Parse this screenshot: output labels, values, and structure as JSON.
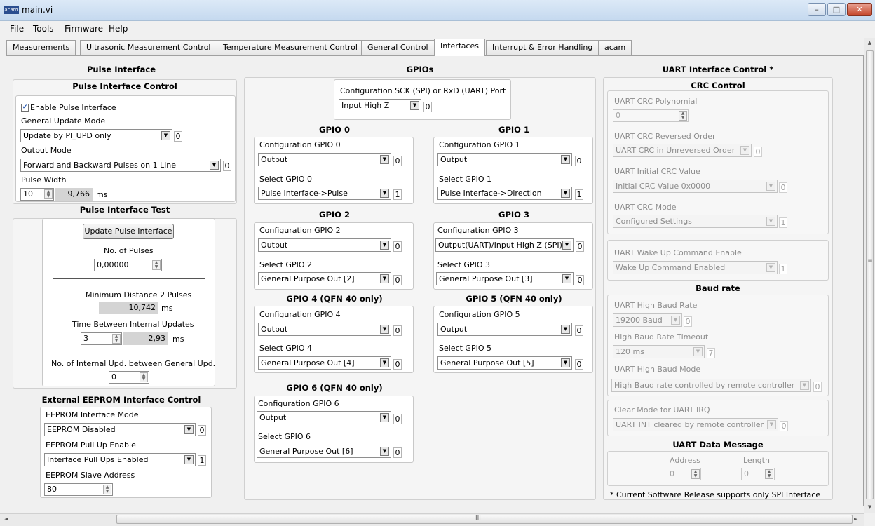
{
  "window": {
    "title": "main.vi",
    "icon_text": "acam",
    "minimize": "–",
    "maximize": "□",
    "close": "✕"
  },
  "menu": [
    "File",
    "Tools",
    "Firmware",
    "Help"
  ],
  "tabs": [
    "Measurements",
    "Ultrasonic Measurement Control",
    "Temperature Measurement Control",
    "General Control",
    "Interfaces",
    "Interrupt & Error Handling",
    "acam"
  ],
  "active_tab": "Interfaces",
  "pulse": {
    "title": "Pulse Interface",
    "control_title": "Pulse Interface Control",
    "enable_label": "Enable Pulse Interface",
    "enable_checked": true,
    "gum_label": "General Update Mode",
    "gum_value": "Update by PI_UPD only",
    "gum_idx": "0",
    "om_label": "Output Mode",
    "om_value": "Forward and Backward Pulses on 1 Line",
    "om_idx": "0",
    "pw_label": "Pulse Width",
    "pw_value": "10",
    "pw_ind": "9,766",
    "pw_unit": "ms",
    "test_title": "Pulse Interface Test",
    "update_btn": "Update Pulse Interface",
    "np_label": "No. of Pulses",
    "np_value": "0,00000",
    "md_label": "Minimum Distance 2 Pulses",
    "md_value": "10,742",
    "md_unit": "ms",
    "tb_label": "Time Between Internal Updates",
    "tb_value": "3",
    "tb_ind": "2,93",
    "tb_unit": "ms",
    "ni_label": "No. of Internal Upd. between General Upd.",
    "ni_value": "0"
  },
  "eeprom": {
    "title": "External EEPROM Interface Control",
    "mode_label": "EEPROM Interface Mode",
    "mode_value": "EEPROM Disabled",
    "mode_idx": "0",
    "pu_label": "EEPROM Pull Up Enable",
    "pu_value": "Interface Pull Ups Enabled",
    "pu_idx": "1",
    "sa_label": "EEPROM Slave Address",
    "sa_value": "80"
  },
  "gpios": {
    "title": "GPIOs",
    "sck_label": "Configuration SCK (SPI) or RxD (UART) Port",
    "sck_value": "Input High Z",
    "sck_idx": "0",
    "items": [
      {
        "title": "GPIO 0",
        "cfg_label": "Configuration GPIO 0",
        "cfg_value": "Output",
        "cfg_idx": "0",
        "sel_label": "Select GPIO 0",
        "sel_value": "Pulse Interface->Pulse",
        "sel_idx": "1"
      },
      {
        "title": "GPIO 1",
        "cfg_label": "Configuration GPIO 1",
        "cfg_value": "Output",
        "cfg_idx": "0",
        "sel_label": "Select GPIO 1",
        "sel_value": "Pulse Interface->Direction",
        "sel_idx": "1"
      },
      {
        "title": "GPIO 2",
        "cfg_label": "Configuration GPIO 2",
        "cfg_value": "Output",
        "cfg_idx": "0",
        "sel_label": "Select GPIO 2",
        "sel_value": "General Purpose Out [2]",
        "sel_idx": "0"
      },
      {
        "title": "GPIO 3",
        "cfg_label": "Configuration GPIO 3",
        "cfg_value": "Output(UART)/Input High Z (SPI)",
        "cfg_idx": "0",
        "sel_label": "Select GPIO 3",
        "sel_value": "General Purpose Out [3]",
        "sel_idx": "0"
      },
      {
        "title": "GPIO 4 (QFN 40 only)",
        "cfg_label": "Configuration GPIO 4",
        "cfg_value": "Output",
        "cfg_idx": "0",
        "sel_label": "Select GPIO 4",
        "sel_value": "General Purpose Out [4]",
        "sel_idx": "0"
      },
      {
        "title": "GPIO 5 (QFN 40 only)",
        "cfg_label": "Configuration GPIO 5",
        "cfg_value": "Output",
        "cfg_idx": "0",
        "sel_label": "Select GPIO 5",
        "sel_value": "General Purpose Out [5]",
        "sel_idx": "0"
      },
      {
        "title": "GPIO 6 (QFN 40 only)",
        "cfg_label": "Configuration GPIO 6",
        "cfg_value": "Output",
        "cfg_idx": "0",
        "sel_label": "Select GPIO 6",
        "sel_value": "General Purpose Out [6]",
        "sel_idx": "0"
      }
    ]
  },
  "uart": {
    "title": "UART Interface Control *",
    "crc_title": "CRC Control",
    "poly_label": "UART CRC Polynomial",
    "poly_value": "0",
    "rev_label": "UART CRC Reversed Order",
    "rev_value": "UART CRC in Unreversed Order",
    "rev_idx": "0",
    "init_label": "UART Initial CRC Value",
    "init_value": "Initial CRC Value 0x0000",
    "init_idx": "0",
    "mode_label": "UART CRC Mode",
    "mode_value": "Configured Settings",
    "mode_idx": "1",
    "wake_label": "UART Wake Up Command Enable",
    "wake_value": "Wake Up Command Enabled",
    "wake_idx": "1",
    "baud_title": "Baud rate",
    "hb_label": "UART High Baud Rate",
    "hb_value": "19200 Baud",
    "hb_idx": "0",
    "hbt_label": "High Baud Rate Timeout",
    "hbt_value": "120 ms",
    "hbt_idx": "7",
    "hbm_label": "UART High Baud Mode",
    "hbm_value": "High Baud rate controlled by remote controller",
    "hbm_idx": "0",
    "clr_label": "Clear Mode for UART IRQ",
    "clr_value": "UART INT cleared by remote controller",
    "clr_idx": "0",
    "msg_title": "UART Data Message",
    "addr_label": "Address",
    "addr_value": "0",
    "len_label": "Length",
    "len_value": "0",
    "note": "* Current Software Release supports only SPI Interface"
  },
  "scrollbar": {
    "up": "▲",
    "down": "▼",
    "left": "◄",
    "right": "►",
    "grip_h": "III",
    "grip_v": "≡"
  }
}
